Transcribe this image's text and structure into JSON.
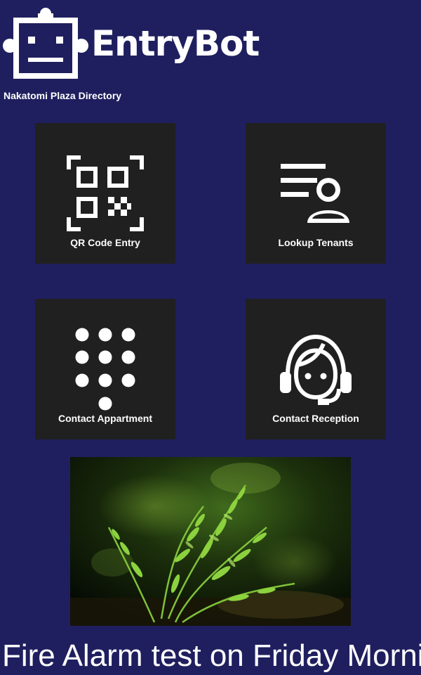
{
  "app": {
    "name": "EntryBot",
    "subtitle": "Nakatomi Plaza Directory"
  },
  "tiles": [
    {
      "label": "QR Code Entry",
      "icon": "qr-code-icon"
    },
    {
      "label": "Lookup Tenants",
      "icon": "person-list-icon"
    },
    {
      "label": "Contact Appartment",
      "icon": "dialpad-icon"
    },
    {
      "label": "Contact Reception",
      "icon": "headset-icon"
    }
  ],
  "banner": {
    "image": "fern-plant-photo"
  },
  "ticker": {
    "text": "Fire Alarm test on Friday Morning"
  },
  "colors": {
    "background": "#1f1f5f",
    "tile": "#202020",
    "foreground": "#ffffff"
  }
}
